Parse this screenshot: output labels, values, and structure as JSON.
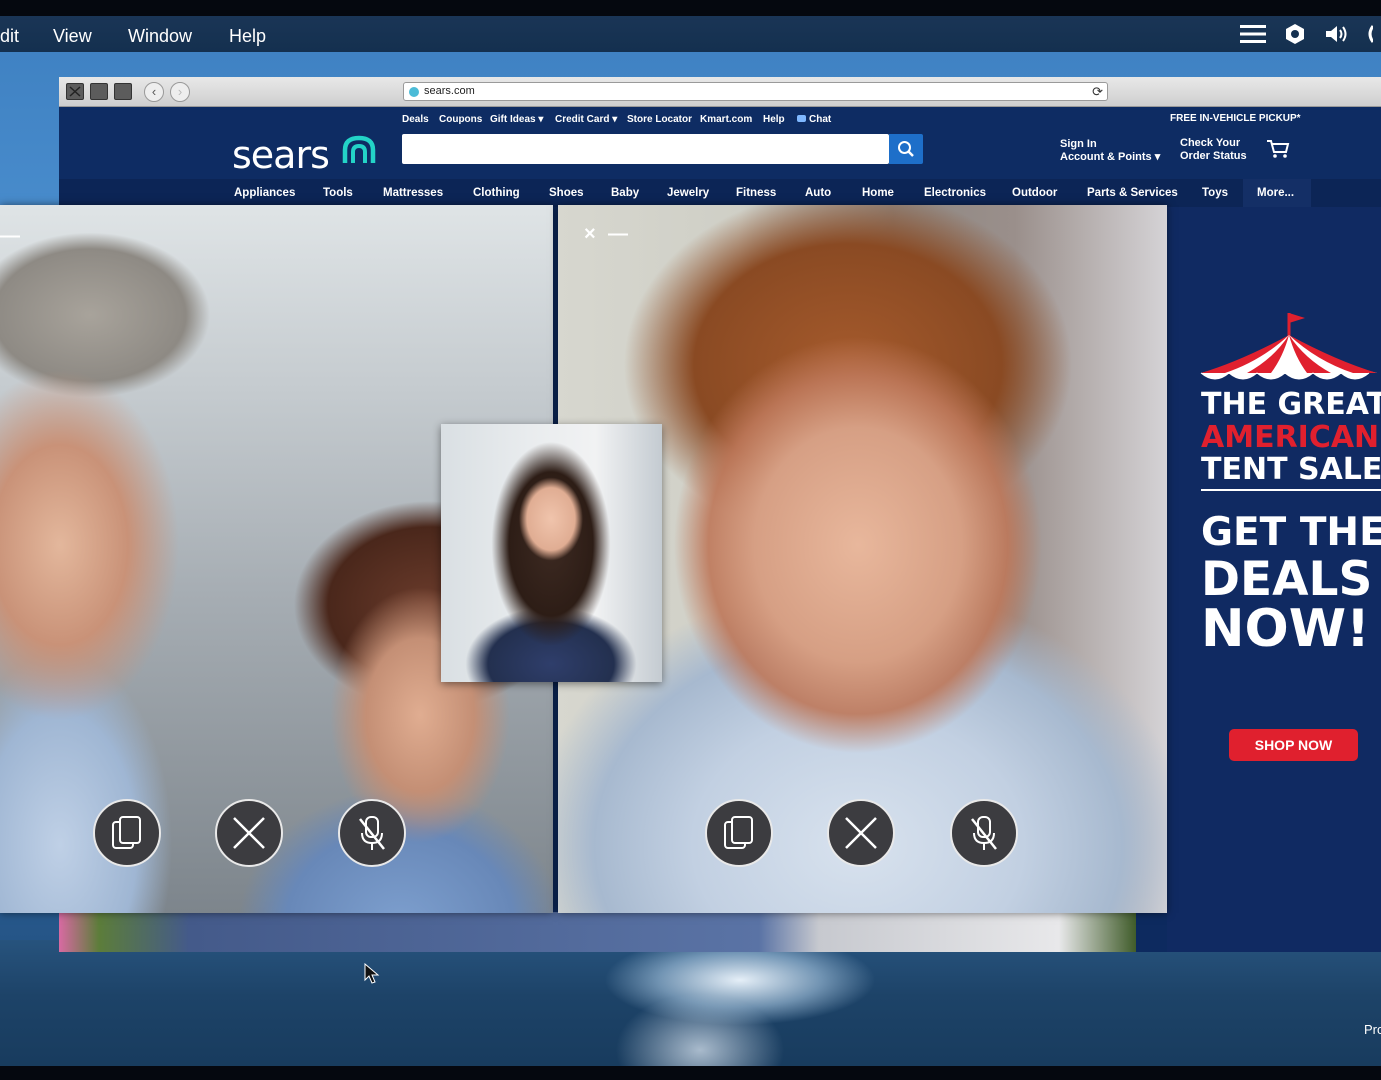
{
  "menubar": {
    "items": [
      "dit",
      "View",
      "Window",
      "Help"
    ],
    "icons": [
      "menu-lines-icon",
      "gear-icon",
      "speaker-icon"
    ]
  },
  "browser": {
    "url": "sears.com"
  },
  "sears": {
    "logo": "sears",
    "utility_links": [
      "Deals",
      "Coupons",
      "Gift Ideas ▾",
      "Credit Card ▾",
      "Store Locator",
      "Kmart.com",
      "Help",
      "Chat"
    ],
    "pickup": "FREE IN-VEHICLE PICKUP*",
    "sign_in_line1": "Sign In",
    "sign_in_line2": "Account & Points ▾",
    "order_line1": "Check Your",
    "order_line2": "Order Status",
    "search_placeholder": "",
    "categories": [
      "Appliances",
      "Tools",
      "Mattresses",
      "Clothing",
      "Shoes",
      "Baby",
      "Jewelry",
      "Fitness",
      "Auto",
      "Home",
      "Electronics",
      "Outdoor",
      "Parts & Services",
      "Toys",
      "More..."
    ]
  },
  "promo": {
    "line1": "THE GREAT",
    "line2": "AMERICAN",
    "line3": "TENT SALE",
    "line4": "GET THE",
    "line5": "DEALS",
    "line6": "NOW!",
    "cta": "SHOP NOW",
    "colors": {
      "red": "#e0202e",
      "navy": "#102a62"
    }
  },
  "video_calls": {
    "right_controls": [
      "×",
      "—"
    ],
    "left_controls": [
      "—"
    ],
    "buttons": [
      "switch-camera-icon",
      "end-call-icon",
      "mute-mic-icon"
    ]
  },
  "desktop": {
    "corner_text": "Pro"
  }
}
